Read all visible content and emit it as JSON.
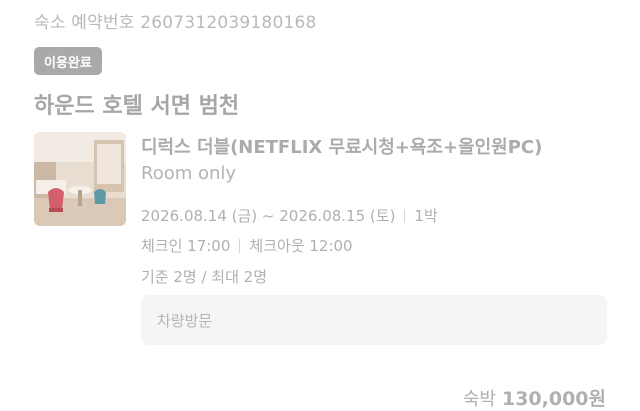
{
  "reservation": {
    "number_label": "숙소 예약번호 2607312039180168",
    "status_badge": "이용완료",
    "hotel_name": "하운드 호텔 서면 범천"
  },
  "room": {
    "name": "디럭스 더블(NETFLIX 무료시청+욕조+올인원PC)",
    "plan": "Room only",
    "thumbnail": "hotel-room-photo"
  },
  "stay": {
    "dates": "2026.08.14 (금) ~ 2026.08.15 (토)",
    "nights": "1박",
    "checkin": "체크인 17:00",
    "checkout": "체크아웃 12:00",
    "guests": "기준 2명 / 최대 2명"
  },
  "vehicle": {
    "label": "차량방문"
  },
  "payment": {
    "label": "숙박",
    "amount": "130,000원"
  }
}
